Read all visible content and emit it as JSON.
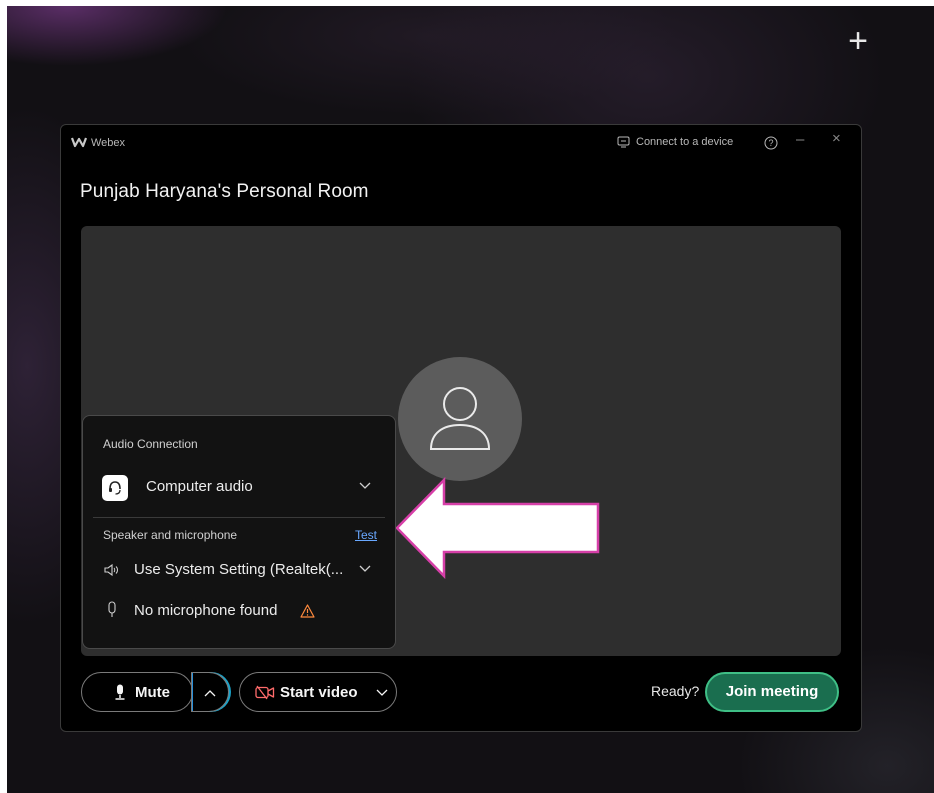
{
  "desktop": {
    "new_tab_symbol": "+"
  },
  "window": {
    "app_name": "Webex",
    "connect_label": "Connect to a device",
    "help_symbol": "?",
    "minimize_symbol": "–",
    "close_symbol": "×",
    "room_title": "Punjab Haryana's Personal Room"
  },
  "audio_popup": {
    "section_title": "Audio Connection",
    "connection_option": "Computer audio",
    "speaker_section_title": "Speaker and microphone",
    "test_link": "Test",
    "speaker_value": "Use System Setting (Realtek(...",
    "microphone_value": "No microphone found"
  },
  "controls": {
    "mute_label": "Mute",
    "video_label": "Start video",
    "ready_text": "Ready?",
    "join_label": "Join meeting"
  },
  "colors": {
    "join_fill": "#1a6e4f",
    "join_border": "#3fbf86",
    "link": "#69a8ff",
    "warning": "#ff8a3d",
    "video_off": "#ff6b6b",
    "arrow_outline": "#d63fa8"
  }
}
